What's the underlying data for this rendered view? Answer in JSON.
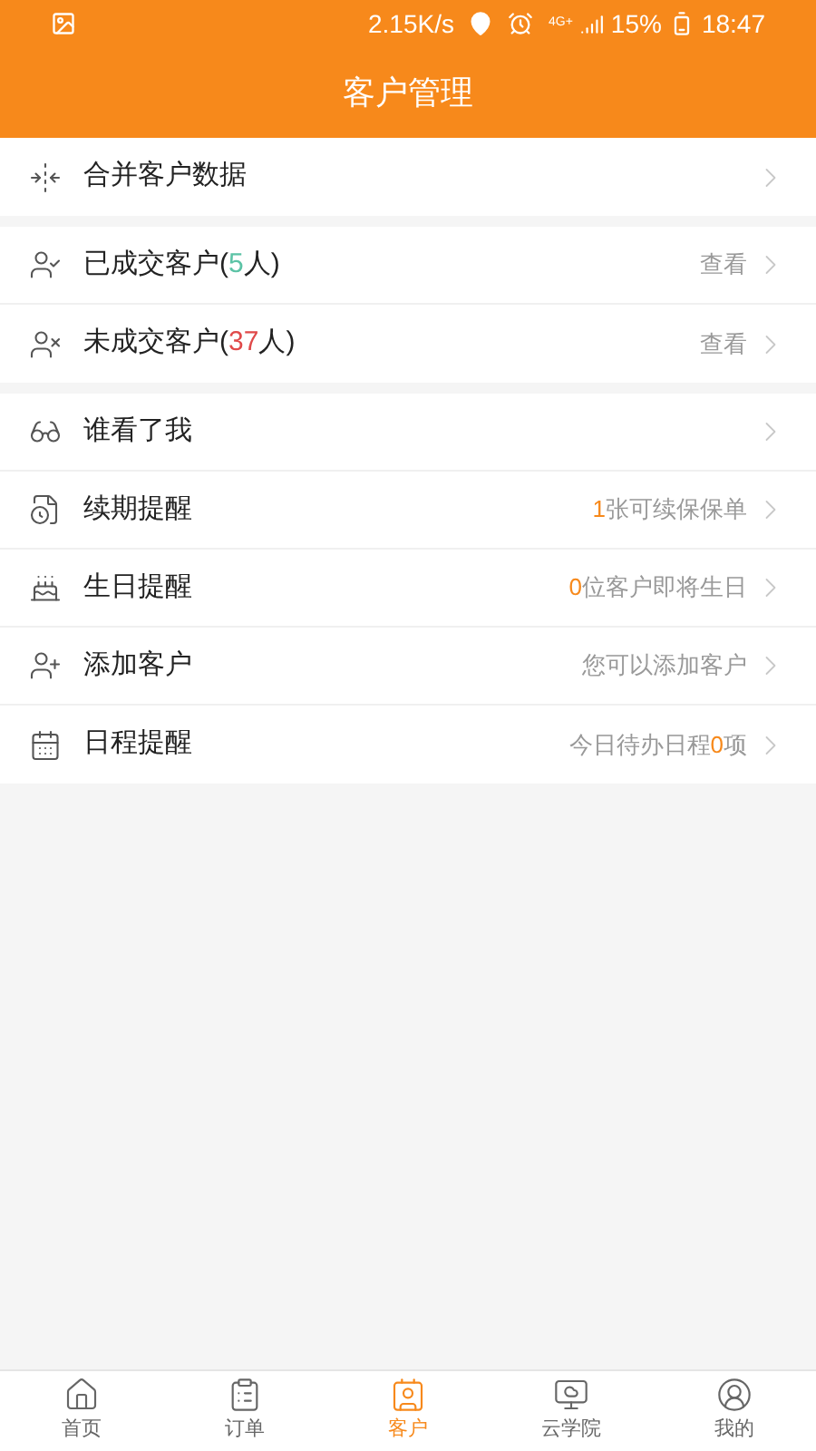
{
  "status_bar": {
    "speed": "2.15K/s",
    "network": "4G+",
    "battery": "15%",
    "time": "18:47"
  },
  "header": {
    "title": "客户管理"
  },
  "sections": [
    {
      "rows": [
        {
          "label": [
            {
              "text": "合并客户数据"
            }
          ]
        }
      ]
    },
    {
      "rows": [
        {
          "label": [
            {
              "text": "已成交客户("
            },
            {
              "text": "5",
              "color": "#5cc3a6"
            },
            {
              "text": "人)"
            }
          ],
          "value": [
            {
              "text": "查看"
            }
          ]
        },
        {
          "label": [
            {
              "text": "未成交客户("
            },
            {
              "text": "37",
              "color": "#e04a4a"
            },
            {
              "text": "人)"
            }
          ],
          "value": [
            {
              "text": "查看"
            }
          ]
        }
      ]
    },
    {
      "rows": [
        {
          "label": [
            {
              "text": "谁看了我"
            }
          ]
        },
        {
          "label": [
            {
              "text": "续期提醒"
            }
          ],
          "value": [
            {
              "text": "1",
              "color": "#f7891b"
            },
            {
              "text": "张可续保保单"
            }
          ]
        },
        {
          "label": [
            {
              "text": "生日提醒"
            }
          ],
          "value": [
            {
              "text": "0",
              "color": "#f7891b"
            },
            {
              "text": "位客户即将生日"
            }
          ]
        },
        {
          "label": [
            {
              "text": "添加客户"
            }
          ],
          "value": [
            {
              "text": "您可以添加客户"
            }
          ]
        },
        {
          "label": [
            {
              "text": "日程提醒"
            }
          ],
          "value": [
            {
              "text": "今日待办日程"
            },
            {
              "text": "0",
              "color": "#f7891b"
            },
            {
              "text": "项"
            }
          ]
        }
      ]
    }
  ],
  "tab_bar": [
    {
      "label": "首页",
      "selected": false
    },
    {
      "label": "订单",
      "selected": false
    },
    {
      "label": "客户",
      "selected": true
    },
    {
      "label": "云学院",
      "selected": false
    },
    {
      "label": "我的",
      "selected": false
    }
  ]
}
